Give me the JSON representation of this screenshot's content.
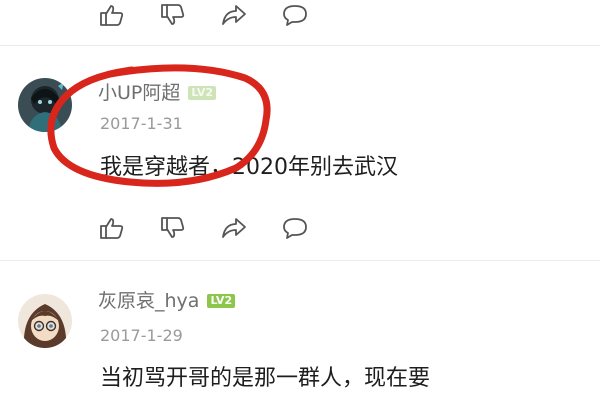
{
  "actions": {
    "like_icon": "thumbs-up-icon",
    "dislike_icon": "thumbs-down-icon",
    "share_icon": "share-icon",
    "reply_icon": "comment-icon"
  },
  "comments": [
    {
      "username": "小UP阿超",
      "level": "LV2",
      "date": "2017-1-31",
      "text": "我是穿越者，2020年别去武汉"
    },
    {
      "username": "灰原哀_hya",
      "level": "LV2",
      "date": "2017-1-29",
      "text": "当初骂开哥的是那一群人，现在要"
    }
  ],
  "colors": {
    "annotation_circle": "#d8261c",
    "level_badge": "#8cc64a"
  }
}
